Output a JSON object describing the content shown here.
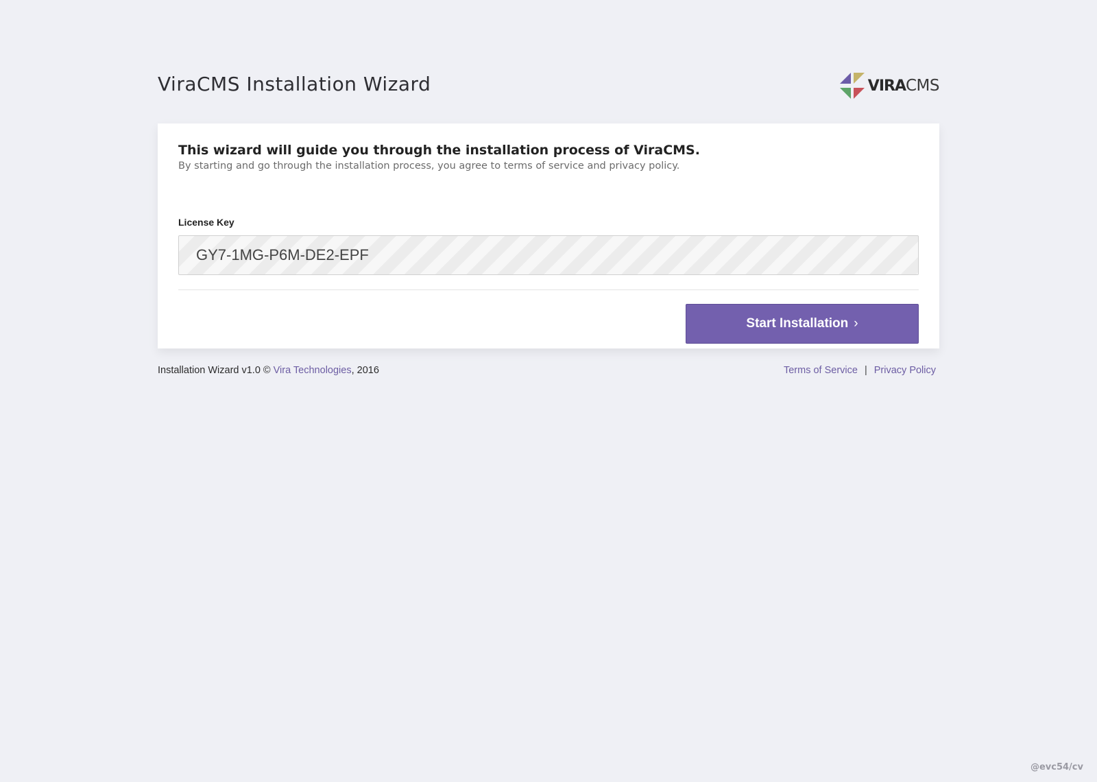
{
  "header": {
    "title": "ViraCMS Installation Wizard",
    "logo": {
      "text_strong": "VIRA",
      "text_light": "CMS",
      "colors": [
        "#6c5ca8",
        "#c5b46a",
        "#5ea468",
        "#c8525a"
      ]
    }
  },
  "card": {
    "intro_title": "This wizard will guide you through the installation process of ViraCMS.",
    "intro_subtitle": "By starting and go through the installation process, you agree to terms of service and privacy policy.",
    "license_label": "License Key",
    "license_value": "GY7-1MG-P6M-DE2-EPF",
    "start_button_label": "Start Installation",
    "start_button_chevron": "›"
  },
  "footer": {
    "left_prefix": "Installation Wizard v1.0 © ",
    "company_link": "Vira Technologies",
    "left_suffix": ", 2016",
    "terms_link": "Terms of Service",
    "separator": "|",
    "privacy_link": "Privacy Policy"
  },
  "watermark": "@evc54/cv",
  "colors": {
    "background": "#eff0f5",
    "accent": "#7360ae",
    "link": "#6c5da3"
  }
}
